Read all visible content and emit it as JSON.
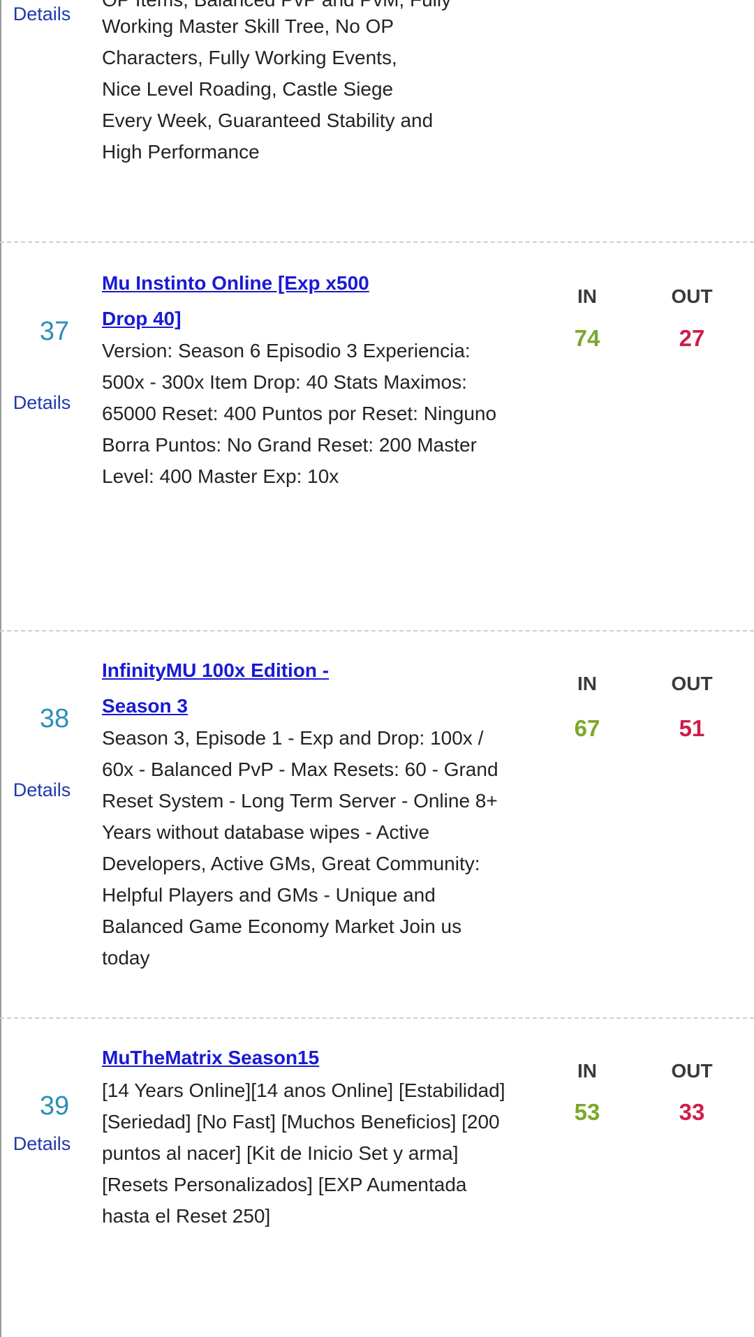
{
  "top_entry": {
    "partial_first_line": "OP Items, Balanced PvP and PvM, Fully",
    "description": "Working Master Skill Tree, No OP Characters, Fully Working Events, Nice Level Roading, Castle Siege Every Week, Guaranteed Stability and High Performance",
    "details_label": "Details"
  },
  "columns": {
    "in_label": "IN",
    "out_label": "OUT"
  },
  "entries": [
    {
      "rank": "37",
      "title": "Mu Instinto Online [Exp x500 Drop 40]",
      "description": "Version: Season 6 Episodio 3 Experiencia: 500x - 300x Item Drop: 40 Stats Maximos: 65000 Reset: 400 Puntos por Reset: Ninguno Borra Puntos: No Grand Reset: 200 Master Level: 400 Master Exp: 10x",
      "details_label": "Details",
      "in": "74",
      "out": "27"
    },
    {
      "rank": "38",
      "title": "InfinityMU 100x Edition - Season 3",
      "description": "Season 3, Episode 1 - Exp and Drop: 100x / 60x - Balanced PvP - Max Resets: 60 - Grand Reset System - Long Term Server - Online 8+ Years without database wipes - Active Developers, Active GMs, Great Community: Helpful Players and GMs - Unique and Balanced Game Economy Market Join us today",
      "details_label": "Details",
      "in": "67",
      "out": "51"
    },
    {
      "rank": "39",
      "title": "MuTheMatrix Season15",
      "description": "[14 Years Online][14 anos Online] [Estabilidad] [Seriedad] [No Fast] [Muchos Beneficios] [200 puntos al nacer] [Kit de Inicio Set y arma] [Resets Personalizados] [EXP Aumentada hasta el Reset 250]",
      "details_label": "Details",
      "in": "53",
      "out": "33"
    }
  ]
}
